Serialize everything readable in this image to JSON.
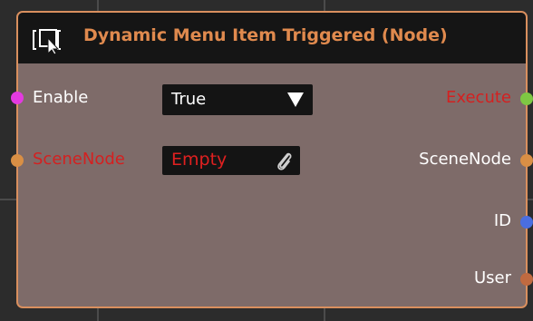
{
  "node": {
    "title": "Dynamic Menu Item Triggered (Node)",
    "border_color": "#d98f5e",
    "header_color": "#151515",
    "body_color": "#7e6b69",
    "title_color": "#e08a4e"
  },
  "inputs": [
    {
      "label": "Enable",
      "pin_color": "#e33ae0",
      "label_color": "#ffffff"
    },
    {
      "label": "SceneNode",
      "pin_color": "#d98f45",
      "label_color": "#d42020"
    }
  ],
  "enable_dropdown": {
    "value": "True",
    "icon": "triangle-down-icon"
  },
  "scenenode_field": {
    "value": "Empty",
    "icon": "paperclip-icon"
  },
  "outputs": [
    {
      "label": "Execute",
      "pin_color": "#7ec843",
      "label_color": "#d42020"
    },
    {
      "label": "SceneNode",
      "pin_color": "#d98f45",
      "label_color": "#ffffff"
    },
    {
      "label": "ID",
      "pin_color": "#4a6ee0",
      "label_color": "#ffffff"
    },
    {
      "label": "User",
      "pin_color": "#c06a40",
      "label_color": "#ffffff"
    }
  ]
}
